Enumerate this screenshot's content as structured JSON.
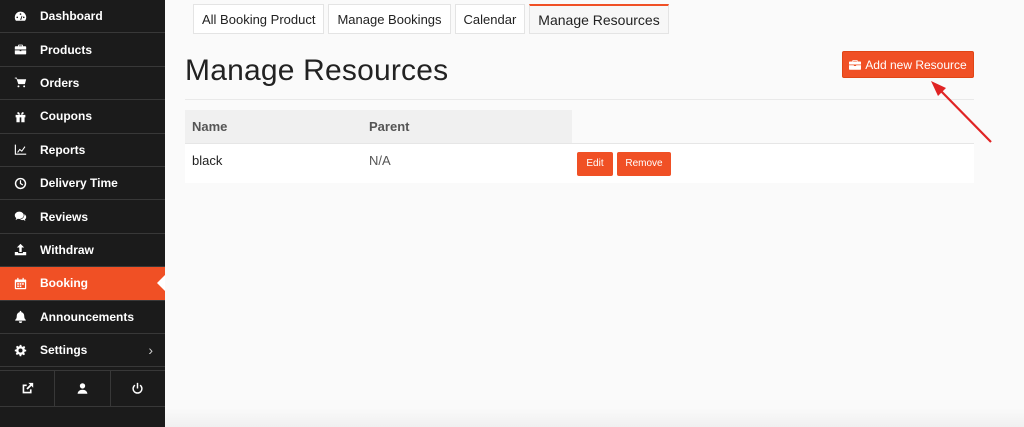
{
  "sidebar": {
    "items": [
      {
        "label": "Dashboard",
        "icon": "dashboard-icon"
      },
      {
        "label": "Products",
        "icon": "briefcase-icon"
      },
      {
        "label": "Orders",
        "icon": "cart-icon"
      },
      {
        "label": "Coupons",
        "icon": "gift-icon"
      },
      {
        "label": "Reports",
        "icon": "line-chart-icon"
      },
      {
        "label": "Delivery Time",
        "icon": "clock-icon"
      },
      {
        "label": "Reviews",
        "icon": "comments-icon"
      },
      {
        "label": "Withdraw",
        "icon": "upload-icon"
      },
      {
        "label": "Booking",
        "icon": "calendar-icon",
        "active": true
      },
      {
        "label": "Announcements",
        "icon": "bell-icon"
      },
      {
        "label": "Settings",
        "icon": "gear-icon",
        "chevron": "›"
      }
    ],
    "footer": [
      "external-link-icon",
      "user-icon",
      "power-icon"
    ]
  },
  "tabs": [
    {
      "label": "All Booking Product"
    },
    {
      "label": "Manage Bookings"
    },
    {
      "label": "Calendar"
    },
    {
      "label": "Manage Resources",
      "active": true
    }
  ],
  "page": {
    "title": "Manage Resources",
    "add_button_label": "Add new Resource"
  },
  "table": {
    "headers": {
      "name": "Name",
      "parent": "Parent"
    },
    "rows": [
      {
        "name": "black",
        "parent": "N/A",
        "edit_label": "Edit",
        "remove_label": "Remove"
      }
    ]
  },
  "colors": {
    "accent": "#f05025",
    "sidebar_bg": "#1b1b1b",
    "arrow": "#e02424"
  }
}
